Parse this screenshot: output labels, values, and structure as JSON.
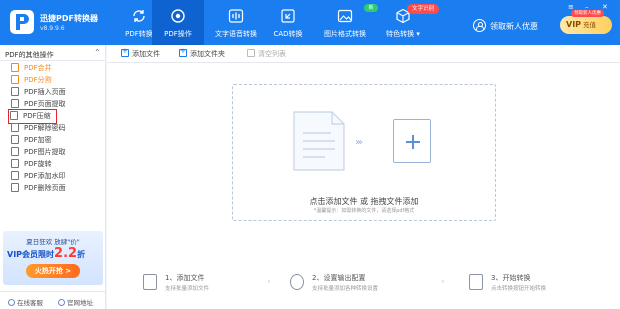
{
  "app": {
    "title": "迅捷PDF转换器",
    "version": "v8.9.9.6"
  },
  "nav": [
    {
      "label": "PDF转换",
      "icon": "refresh-icon"
    },
    {
      "label": "PDF操作",
      "icon": "target-icon",
      "active": true
    },
    {
      "label": "文字语音转换",
      "icon": "waveform-icon"
    },
    {
      "label": "CAD转换",
      "icon": "cad-icon"
    },
    {
      "label": "图片格式转换",
      "icon": "image-icon",
      "badge": "新"
    },
    {
      "label": "特色转换",
      "icon": "cube-icon",
      "badge": "文字识别",
      "has_dropdown": true
    }
  ],
  "user": {
    "link_text": "领取新人优惠",
    "vip_label": "VIP",
    "vip_action": "充值",
    "vip_tip": "领取新人优惠"
  },
  "sidebar": {
    "title": "PDF的其他操作",
    "items": [
      {
        "label": "PDF合并",
        "style": "orange"
      },
      {
        "label": "PDF分割",
        "style": "orange"
      },
      {
        "label": "PDF插入页面"
      },
      {
        "label": "PDF页面提取"
      },
      {
        "label": "PDF压缩",
        "highlighted": true
      },
      {
        "label": "PDF解除密码"
      },
      {
        "label": "PDF加密"
      },
      {
        "label": "PDF图片提取"
      },
      {
        "label": "PDF旋转"
      },
      {
        "label": "PDF添加水印"
      },
      {
        "label": "PDF删除页面"
      }
    ],
    "promo": {
      "line1": "夏日狂欢  放肆\"价\"",
      "line2_prefix": "VIP会员限时",
      "line2_value": "2.2",
      "line2_suffix": "折",
      "button": "火热开抢 >"
    },
    "footer": {
      "support": "在线客服",
      "website": "官网地址"
    }
  },
  "toolbar": {
    "add_file": "添加文件",
    "add_folder": "添加文件夹",
    "clear_list": "清空列表"
  },
  "dropzone": {
    "title": "点击添加文件 或 拖拽文件添加",
    "subtitle": "*温馨提示：如需转换的文件，请选择pdf格式"
  },
  "steps": [
    {
      "title": "1、添加文件",
      "subtitle": "支持批量添加文件"
    },
    {
      "title": "2、设置输出配置",
      "subtitle": "支持批量添加各种转换设置"
    },
    {
      "title": "3、开始转换",
      "subtitle": "点击转换按钮开始转换"
    }
  ],
  "colors": {
    "primary": "#1b7ef0",
    "active_nav": "#0f63d0",
    "accent_orange": "#f08a1c",
    "highlight_red": "#e0262a"
  }
}
